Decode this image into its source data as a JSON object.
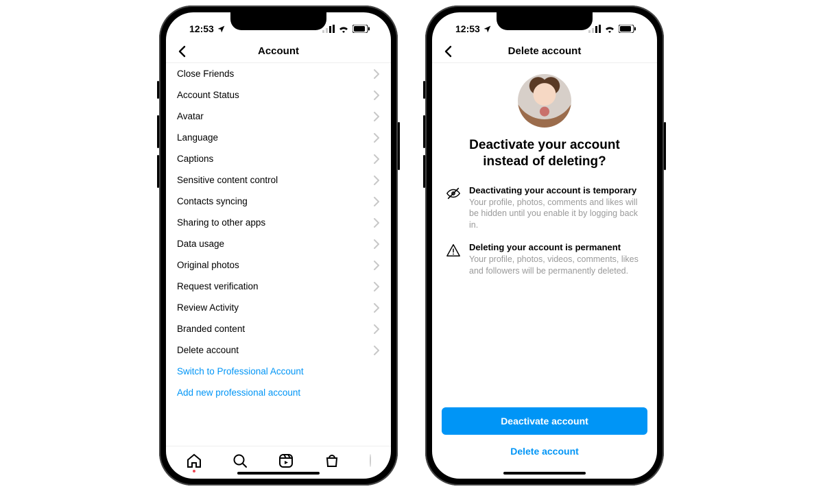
{
  "status": {
    "time": "12:53"
  },
  "left": {
    "title": "Account",
    "items": [
      "Close Friends",
      "Account Status",
      "Avatar",
      "Language",
      "Captions",
      "Sensitive content control",
      "Contacts syncing",
      "Sharing to other apps",
      "Data usage",
      "Original photos",
      "Request verification",
      "Review Activity",
      "Branded content",
      "Delete account"
    ],
    "links": [
      "Switch to Professional Account",
      "Add new professional account"
    ]
  },
  "right": {
    "title": "Delete account",
    "heading": "Deactivate your account instead of deleting?",
    "info": [
      {
        "icon": "eye-off",
        "title": "Deactivating your account is temporary",
        "desc": "Your profile, photos, comments and likes will be hidden until you enable it by logging back in."
      },
      {
        "icon": "warning",
        "title": "Deleting your account is permanent",
        "desc": "Your profile, photos, videos, comments, likes and followers will be permanently deleted."
      }
    ],
    "primary": "Deactivate account",
    "secondary": "Delete account"
  }
}
